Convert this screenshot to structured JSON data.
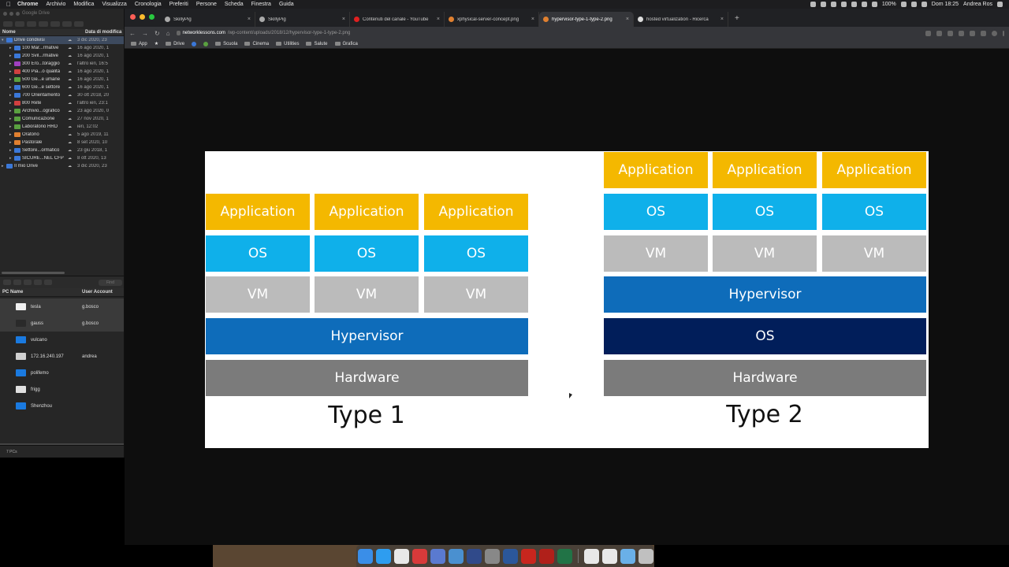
{
  "menubar": {
    "app": "Chrome",
    "items": [
      "Archivio",
      "Modifica",
      "Visualizza",
      "Cronologia",
      "Preferiti",
      "Persone",
      "Scheda",
      "Finestra",
      "Guida"
    ],
    "battery": "100%",
    "datetime": "Dom 18:25",
    "user": "Andrea Ros"
  },
  "left_pane": {
    "title": "Google Drive",
    "columns": {
      "name": "Nome",
      "date": "Data di modifica"
    },
    "rows": [
      {
        "name": "Drive condivisi",
        "date": "3 dic 2020, 23",
        "color": "#3b78d8"
      },
      {
        "name": "100 Mar...rmative",
        "date": "16 ago 2020, 1",
        "color": "#3b78d8"
      },
      {
        "name": "200 Svil...rmative",
        "date": "16 ago 2020, 1",
        "color": "#3b78d8"
      },
      {
        "name": "300 Ero...toraggio",
        "date": "l'altro ieri, 16:5",
        "color": "#a040c0"
      },
      {
        "name": "400 Pia...o qualità",
        "date": "16 ago 2020, 1",
        "color": "#d04040"
      },
      {
        "name": "500 Ge...e umane",
        "date": "16 ago 2020, 1",
        "color": "#5aa040"
      },
      {
        "name": "600 Ge...e settore",
        "date": "16 ago 2020, 1",
        "color": "#3b78d8"
      },
      {
        "name": "700 Orientamento",
        "date": "30 ott 2018, 20",
        "color": "#3b78d8"
      },
      {
        "name": "800 Rete",
        "date": "l'altro ieri, 23:1",
        "color": "#d04040"
      },
      {
        "name": "Archivio...ografico",
        "date": "23 ago 2020, 0",
        "color": "#5aa040"
      },
      {
        "name": "Comunicazione",
        "date": "27 nov 2020, 1",
        "color": "#5aa040"
      },
      {
        "name": "Laboratorio HRD",
        "date": "ieri, 12:02",
        "color": "#5aa040"
      },
      {
        "name": "Oratorio",
        "date": "5 ago 2019, 11",
        "color": "#e08030"
      },
      {
        "name": "Pastorale",
        "date": "8 set 2020, 10",
        "color": "#e08030"
      },
      {
        "name": "Settore...ormatico",
        "date": "23 giu 2018, 1",
        "color": "#3b78d8"
      },
      {
        "name": "SICURE...NEL CFP",
        "date": "8 ott 2020, 13",
        "color": "#3b78d8"
      },
      {
        "name": "Il mio Drive",
        "date": "3 dic 2020, 23",
        "color": "#3b78d8"
      }
    ],
    "search_placeholder": "Find",
    "pc_columns": {
      "name": "PC Name",
      "account": "User Account"
    },
    "pcs": [
      {
        "name": "tesla",
        "account": "g.bosco",
        "color": "#f0f0f0"
      },
      {
        "name": "gauss",
        "account": "g.bosco",
        "color": "#2a2a2a"
      },
      {
        "name": "vulcano",
        "account": "",
        "color": "#1a7ae0"
      },
      {
        "name": "172.16.240.197",
        "account": "andrea",
        "color": "#d0d0d0"
      },
      {
        "name": "polifemo",
        "account": "",
        "color": "#1a7ae0"
      },
      {
        "name": "frigg",
        "account": "",
        "color": "#e0e0e0"
      },
      {
        "name": "Shenzhou",
        "account": "",
        "color": "#1a7ae0"
      }
    ],
    "footer": "7 PCs"
  },
  "browser": {
    "tabs": [
      {
        "title": "SkillyPig",
        "active": false
      },
      {
        "title": "SkillyPig",
        "active": false
      },
      {
        "title": "Contenuti del canale - YouTube",
        "active": false
      },
      {
        "title": "xphysical-server-concept.png",
        "active": false
      },
      {
        "title": "hypervisor-type-1-type-2.png",
        "active": true
      },
      {
        "title": "hosted virtualization - Ricerca",
        "active": false
      }
    ],
    "url_host": "networklessons.com",
    "url_path": "/wp-content/uploads/2018/12/hypervisor-type-1-type-2.png",
    "bookmarks": [
      "App",
      "Drive",
      "Scuola",
      "Cinema",
      "Utilities",
      "Salute",
      "Grafica"
    ]
  },
  "diagram": {
    "type1": {
      "label": "Type 1",
      "applications": [
        "Application",
        "Application",
        "Application"
      ],
      "os": [
        "OS",
        "OS",
        "OS"
      ],
      "vms": [
        "VM",
        "VM",
        "VM"
      ],
      "hypervisor": "Hypervisor",
      "hardware": "Hardware"
    },
    "type2": {
      "label": "Type 2",
      "applications": [
        "Application",
        "Application",
        "Application"
      ],
      "os": [
        "OS",
        "OS",
        "OS"
      ],
      "vms": [
        "VM",
        "VM",
        "VM"
      ],
      "hypervisor": "Hypervisor",
      "host_os": "OS",
      "hardware": "Hardware"
    }
  }
}
